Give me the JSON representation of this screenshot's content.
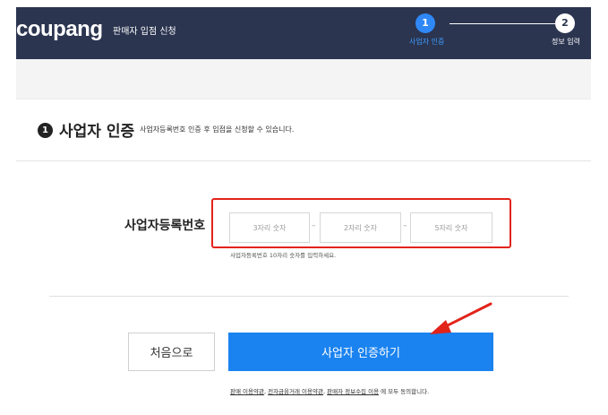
{
  "header": {
    "logo": "coupang",
    "subtitle": "판매자 입점 신청",
    "steps": [
      {
        "number": "1",
        "label": "사업자 인증",
        "active": true
      },
      {
        "number": "2",
        "label": "정보 입력",
        "active": false
      }
    ]
  },
  "section": {
    "number": "1",
    "title": "사업자 인증",
    "description": "사업자등록번호 인증 후 입점을 신청할 수 있습니다."
  },
  "form": {
    "label": "사업자등록번호",
    "inputs": [
      {
        "placeholder": "3자리 숫자",
        "value": ""
      },
      {
        "placeholder": "2자리 숫자",
        "value": ""
      },
      {
        "placeholder": "5자리 숫자",
        "value": ""
      }
    ],
    "separator": "–",
    "helper": "사업자등록번호 10자리 숫자를 입력하세요."
  },
  "buttons": {
    "back": "처음으로",
    "verify": "사업자 인증하기"
  },
  "terms": {
    "link1": "판매 이용약관",
    "sep": ", ",
    "link2": "전자금융거래 이용약관",
    "link3": "판매자 정보수집 이용",
    "suffix": " 에 모두 동의합니다."
  },
  "colors": {
    "header_bg": "#2b3550",
    "accent": "#1a83f0",
    "highlight": "#e2231a"
  }
}
